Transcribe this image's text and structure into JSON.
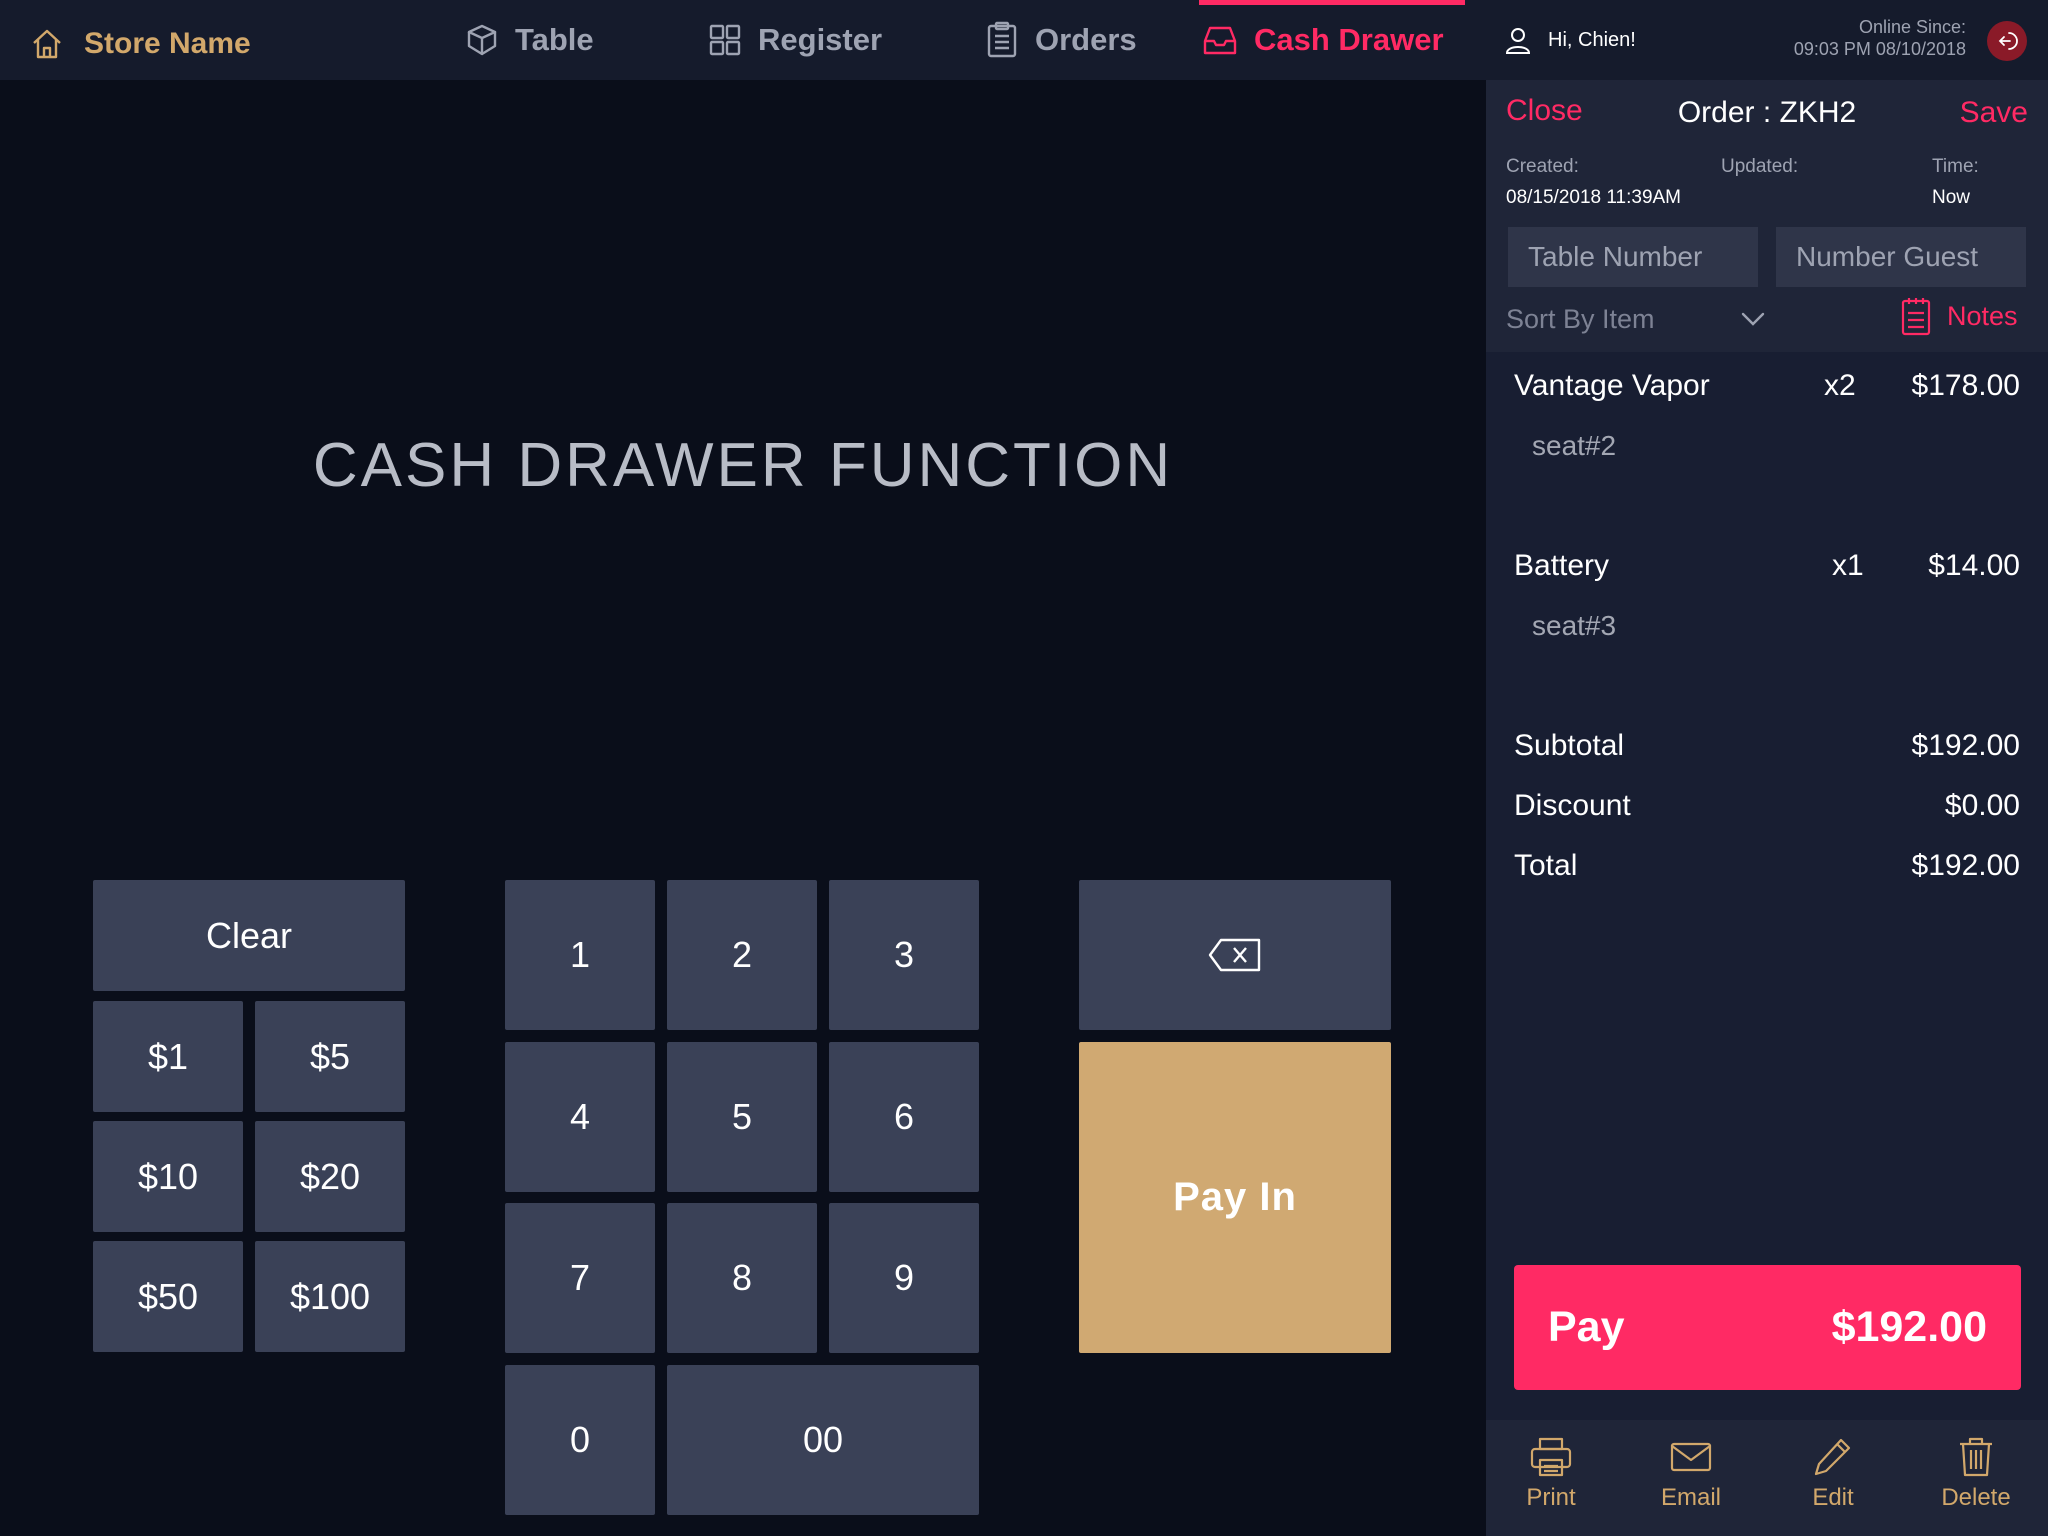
{
  "topbar": {
    "store_name": "Store Name",
    "nav": [
      {
        "label": "Table",
        "icon": "cube-icon"
      },
      {
        "label": "Register",
        "icon": "grid-icon"
      },
      {
        "label": "Orders",
        "icon": "clipboard-icon"
      },
      {
        "label": "Cash Drawer",
        "icon": "tray-icon",
        "active": true
      }
    ],
    "greeting": "Hi, Chien!",
    "online_since_label": "Online Since:",
    "online_since_value": "09:03 PM 08/10/2018"
  },
  "main": {
    "title": "CASH DRAWER FUNCTION",
    "clear_label": "Clear",
    "quick_amounts": [
      "$1",
      "$5",
      "$10",
      "$20",
      "$50",
      "$100"
    ],
    "digits": [
      "1",
      "2",
      "3",
      "4",
      "5",
      "6",
      "7",
      "8",
      "9",
      "0",
      "00"
    ],
    "pay_in_label": "Pay In"
  },
  "order": {
    "close_label": "Close",
    "title": "Order : ZKH2",
    "save_label": "Save",
    "created_label": "Created:",
    "created_value": "08/15/2018 11:39AM",
    "updated_label": "Updated:",
    "time_label": "Time:",
    "time_value": "Now",
    "table_number_placeholder": "Table Number",
    "number_guest_placeholder": "Number Guest",
    "sort_label": "Sort By Item",
    "notes_label": "Notes",
    "items": [
      {
        "name": "Vantage Vapor",
        "qty": "x2",
        "price": "$178.00",
        "seat": "seat#2"
      },
      {
        "name": "Battery",
        "qty": "x1",
        "price": "$14.00",
        "seat": "seat#3"
      }
    ],
    "subtotal_label": "Subtotal",
    "subtotal_value": "$192.00",
    "discount_label": "Discount",
    "discount_value": "$0.00",
    "total_label": "Total",
    "total_value": "$192.00",
    "pay_label": "Pay",
    "pay_amount": "$192.00",
    "actions": [
      "Print",
      "Email",
      "Edit",
      "Delete"
    ]
  },
  "colors": {
    "accent": "#ff2a64",
    "gold": "#d0a972",
    "background": "#0a0e1a",
    "key": "#3a4157"
  }
}
